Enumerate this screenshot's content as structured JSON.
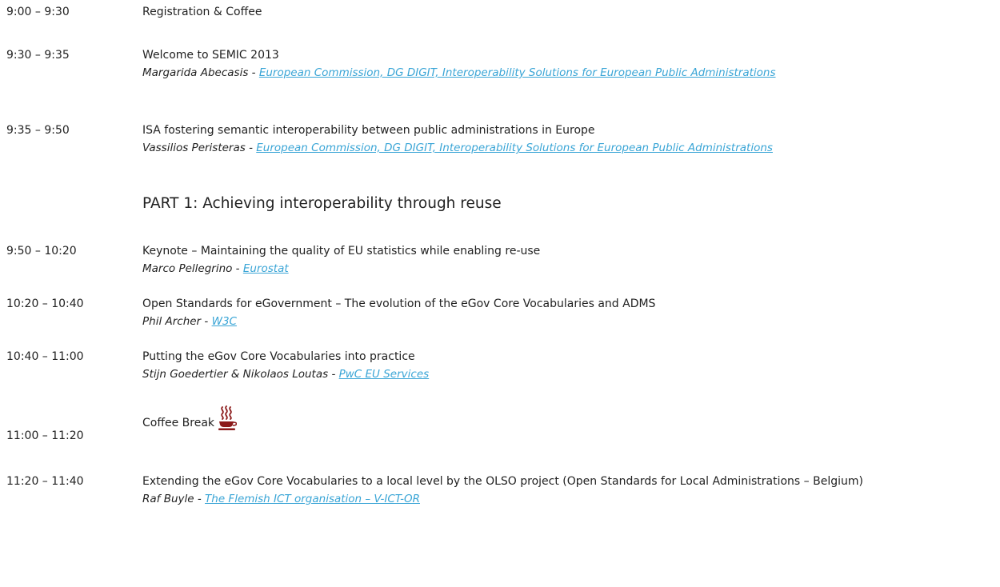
{
  "agenda": {
    "items": [
      {
        "time": "9:00 – 9:30",
        "title": "Registration & Coffee"
      },
      {
        "time": "9:30 – 9:35",
        "title": "Welcome to SEMIC 2013",
        "speaker": "Margarida Abecasis",
        "org": "European Commission, DG DIGIT, Interoperability Solutions for European Public Administrations"
      },
      {
        "time": "9:35 – 9:50",
        "title": "ISA fostering semantic interoperability between public administrations in Europe",
        "speaker": "Vassilios Peristeras",
        "org": "European Commission, DG DIGIT, Interoperability Solutions for European Public Administrations"
      },
      {
        "time": "9:50 – 10:20",
        "title": "Keynote – Maintaining the quality of EU statistics while enabling re-use",
        "speaker": "Marco Pellegrino",
        "org": "Eurostat"
      },
      {
        "time": "10:20 – 10:40",
        "title": "Open Standards for eGovernment – The evolution of the eGov Core Vocabularies and ADMS",
        "speaker": "Phil Archer",
        "org": "W3C"
      },
      {
        "time": "10:40 – 11:00",
        "title": "Putting the eGov Core Vocabularies into practice",
        "speaker": "Stijn Goedertier & Nikolaos Loutas",
        "org": "PwC EU Services"
      },
      {
        "time": "11:00 – 11:20",
        "title": "Coffee Break"
      },
      {
        "time": "11:20 – 11:40",
        "title": "Extending the eGov Core Vocabularies to a local level by the OLSO project (Open Standards for Local Administrations – Belgium)",
        "speaker": "Raf Buyle",
        "org": "The Flemish ICT organisation – V-ICT-OR"
      }
    ],
    "section_heading": "PART 1: Achieving interoperability through reuse",
    "separator": " - "
  },
  "colors": {
    "link": "#3aa5d6",
    "text": "#222222",
    "coffee_icon": "#8b1a1a"
  },
  "icons": {
    "coffee_break": "coffee-cup-icon"
  }
}
